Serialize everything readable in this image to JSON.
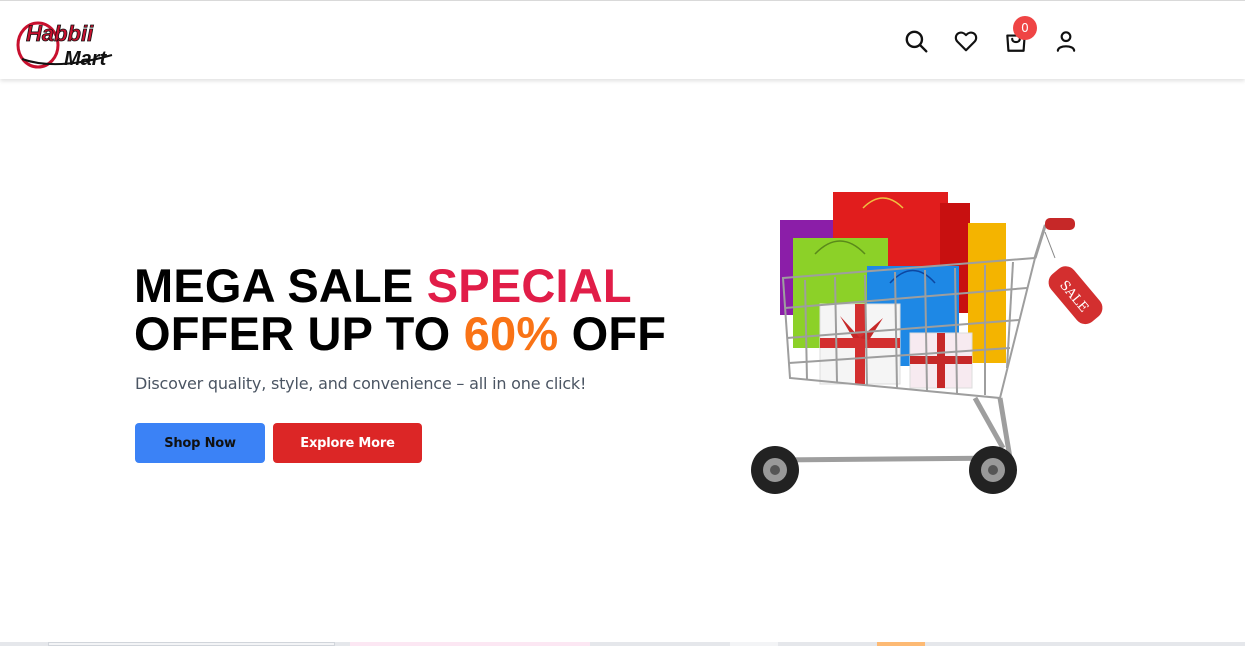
{
  "brand": {
    "line1": "Habbii",
    "line2": "Mart"
  },
  "header": {
    "icons": [
      "search-icon",
      "heart-icon",
      "shopping-bag-icon",
      "user-icon"
    ],
    "cart_count": "0"
  },
  "hero": {
    "title_part1": "MEGA SALE ",
    "title_special": "SPECIAL",
    "title_part2": "OFFER UP TO ",
    "title_percent": "60%",
    "title_part3": " OFF",
    "subtitle": "Discover quality, style, and convenience – all in one click!",
    "shop_label": "Shop Now",
    "explore_label": "Explore More",
    "sale_tag": "SALE"
  },
  "colors": {
    "special": "#e11d48",
    "percent": "#f97316",
    "shop_button": "#3b82f6",
    "explore_button": "#dc2626",
    "badge": "#ef4444"
  }
}
